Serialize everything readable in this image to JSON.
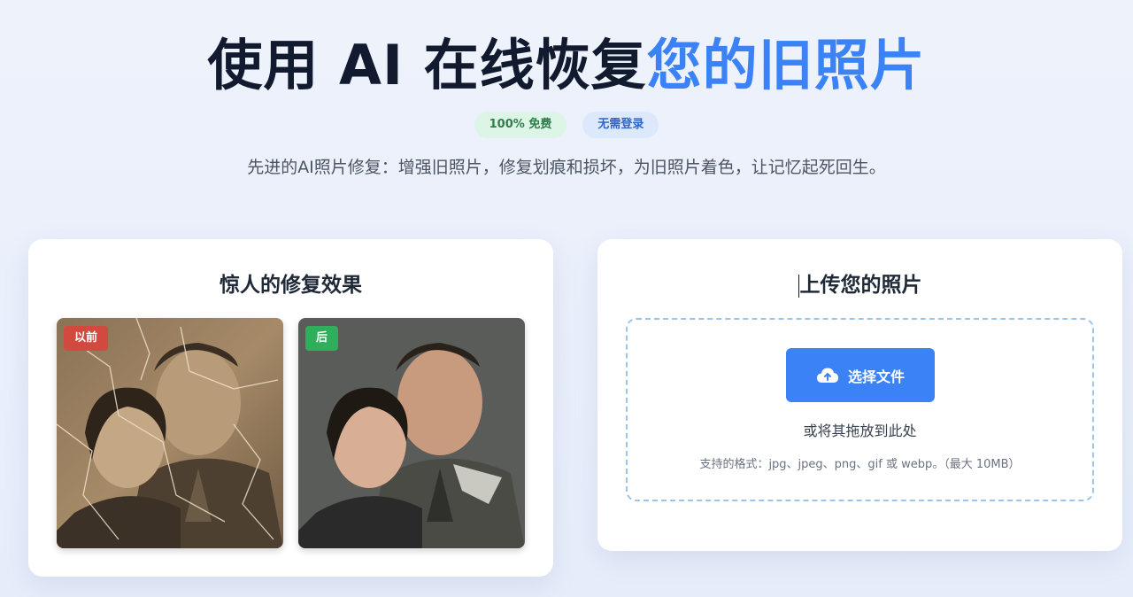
{
  "hero": {
    "title_main": "使用 AI 在线恢复",
    "title_accent": "您的旧照片",
    "badge_free": "100% 免费",
    "badge_login": "无需登录",
    "subtitle": "先进的AI照片修复：增强旧照片，修复划痕和损坏，为旧照片着色，让记忆起死回生。"
  },
  "demo": {
    "title": "惊人的修复效果",
    "before_label": "以前",
    "after_label": "后"
  },
  "upload": {
    "title": "上传您的照片",
    "button_label": "选择文件",
    "drop_text": "或将其拖放到此处",
    "formats": "支持的格式：jpg、jpeg、png、gif 或 webp。（最大 10MB）"
  },
  "colors": {
    "accent": "#3b82f6",
    "before_tag": "#d24a3f",
    "after_tag": "#2fae5b"
  }
}
